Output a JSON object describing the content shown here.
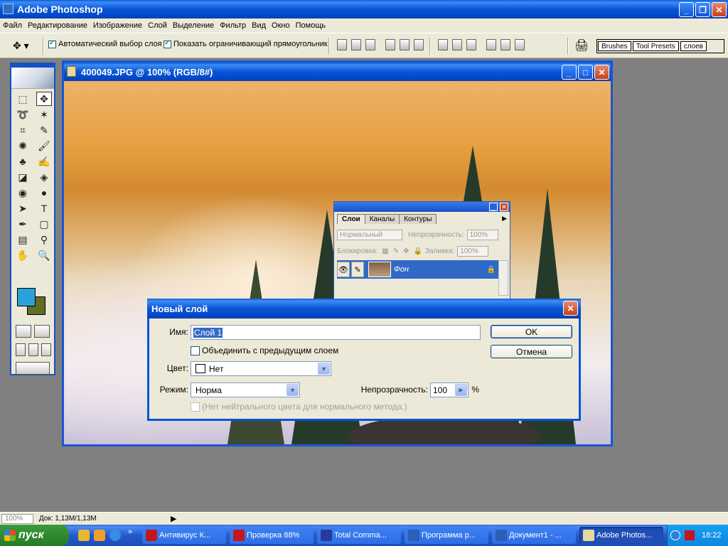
{
  "app": {
    "title": "Adobe Photoshop"
  },
  "menu": [
    "Файл",
    "Редактирование",
    "Изображение",
    "Слой",
    "Выделение",
    "Фильтр",
    "Вид",
    "Окно",
    "Помощь"
  ],
  "options": {
    "auto_select": "Автоматический выбор слоя",
    "show_bounds": "Показать ограничивающий прямоугольник",
    "palette_tabs": [
      "Brushes",
      "Tool Presets",
      "слоев"
    ]
  },
  "document": {
    "title": "400049.JPG @ 100% (RGB/8#)"
  },
  "colors": {
    "foreground": "#2aa1d9",
    "background": "#646c24"
  },
  "layers_palette": {
    "tabs": [
      "Слои",
      "Каналы",
      "Контуры"
    ],
    "blend_mode": "Нормальный",
    "opacity_label": "Непрозрачность:",
    "opacity_value": "100%",
    "lock_label": "Блокировка:",
    "fill_label": "Заливка:",
    "fill_value": "100%",
    "layer_name": "Фон"
  },
  "dialog": {
    "title": "Новый слой",
    "name_label": "Имя:",
    "name_value": "Слой 1",
    "group_label": "Объединить с предыдущим слоем",
    "color_label": "Цвет:",
    "color_value": "Нет",
    "mode_label": "Режим:",
    "mode_value": "Норма",
    "opacity_label": "Непрозрачность:",
    "opacity_value": "100",
    "opacity_unit": "%",
    "neutral_label": "(Нет нейтрального цвета для нормального метода.)",
    "ok": "OK",
    "cancel": "Отмена"
  },
  "status": {
    "zoom": "100%",
    "doc": "Док: 1,13M/1,13M"
  },
  "taskbar": {
    "start": "пуск",
    "tasks": [
      "Антивирус К...",
      "Проверка 88%",
      "Total Comma...",
      "Программа р...",
      "Документ1 - ...",
      "Adobe Photos..."
    ],
    "clock": "18:22"
  }
}
